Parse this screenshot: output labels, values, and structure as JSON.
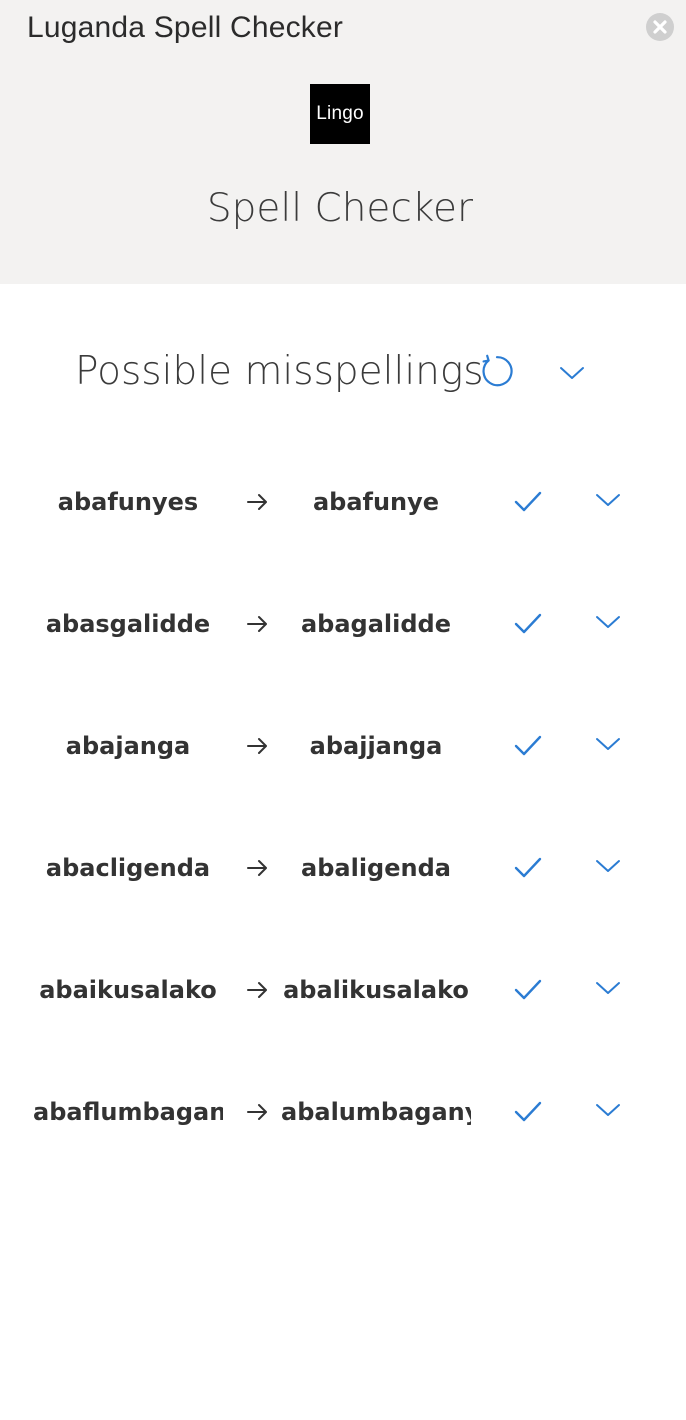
{
  "window": {
    "title": "Luganda Spell Checker",
    "close_icon": "close-icon"
  },
  "header": {
    "logo_text": "Lingo",
    "subtitle": "Spell Checker",
    "background_color": "#f3f2f1"
  },
  "section": {
    "title": "Possible misspellings",
    "refresh_icon": "refresh-icon",
    "toggle_icon": "chevron-down-icon"
  },
  "suggestions": [
    {
      "misspelled": "abafunyes",
      "corrected": "abafunye"
    },
    {
      "misspelled": "abasgalidde",
      "corrected": "abagalidde"
    },
    {
      "misspelled": "abajanga",
      "corrected": "abajjanga"
    },
    {
      "misspelled": "abacligenda",
      "corrected": "abaligenda"
    },
    {
      "misspelled": "abaikusalako",
      "corrected": "abalikusalako"
    },
    {
      "misspelled": "abaflumbaganyi",
      "corrected": "abalumbaganyi"
    }
  ],
  "icons": {
    "arrow": "arrow-right-icon",
    "accept": "checkmark-icon",
    "expand": "chevron-down-icon"
  },
  "colors": {
    "accent": "#2b7cd3",
    "text": "#333333"
  }
}
